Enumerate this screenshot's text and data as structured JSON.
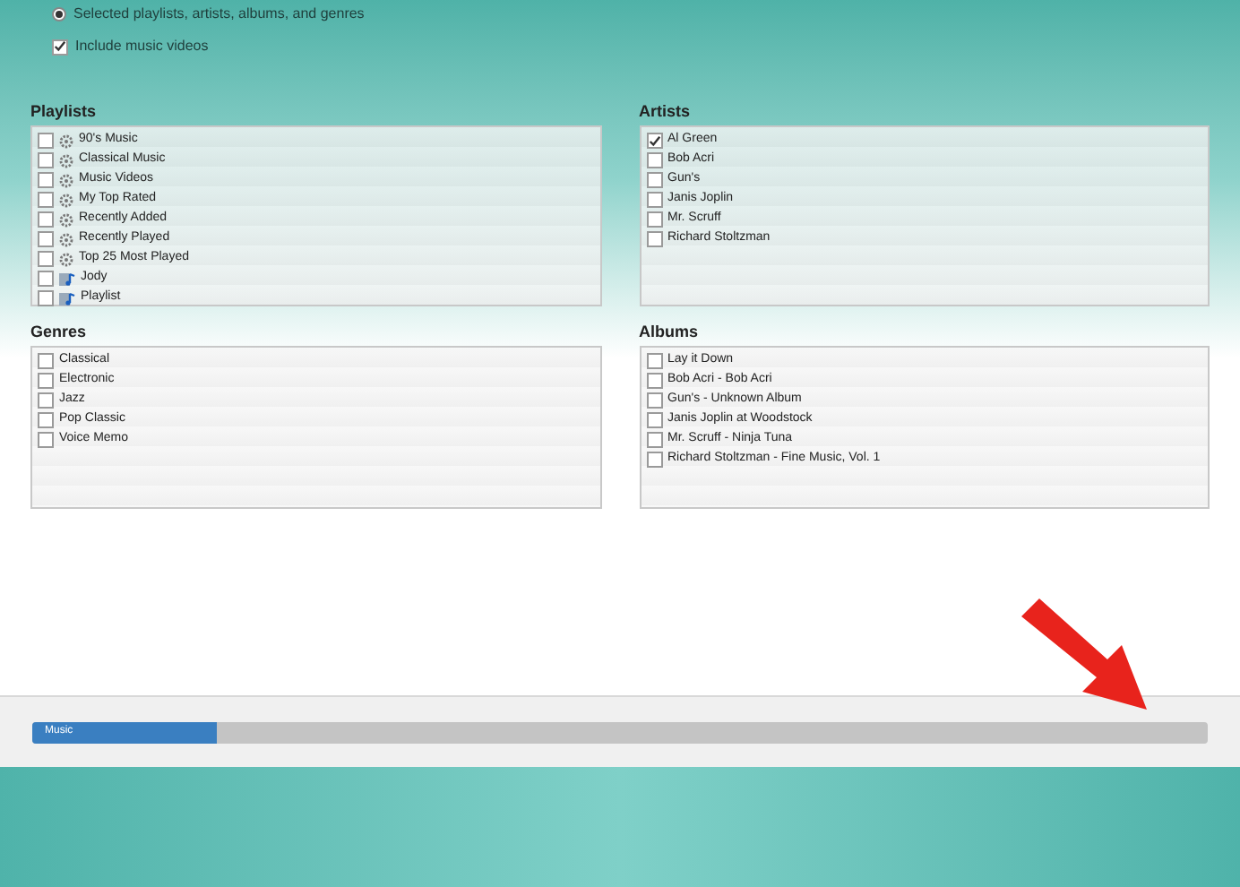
{
  "sync_options": [
    {
      "kind": "radio",
      "label": "Selected playlists, artists, albums, and genres",
      "selected": true
    },
    {
      "kind": "checkbox",
      "label": "Include music videos",
      "checked": true
    }
  ],
  "playlists": {
    "title": "Playlists",
    "items": [
      {
        "label": "90's Music",
        "kind": "smart",
        "checked": false
      },
      {
        "label": "Classical Music",
        "kind": "smart",
        "checked": false
      },
      {
        "label": "Music Videos",
        "kind": "smart",
        "checked": false
      },
      {
        "label": "My Top Rated",
        "kind": "smart",
        "checked": false
      },
      {
        "label": "Recently Added",
        "kind": "smart",
        "checked": false
      },
      {
        "label": "Recently Played",
        "kind": "smart",
        "checked": false
      },
      {
        "label": "Top 25 Most Played",
        "kind": "smart",
        "checked": false
      },
      {
        "label": "Jody",
        "kind": "regular",
        "checked": false
      },
      {
        "label": "Playlist",
        "kind": "regular",
        "checked": false
      }
    ]
  },
  "artists": {
    "title": "Artists",
    "items": [
      {
        "label": "Al Green",
        "checked": true
      },
      {
        "label": "Bob Acri",
        "checked": false
      },
      {
        "label": "Gun's",
        "checked": false
      },
      {
        "label": "Janis Joplin",
        "checked": false
      },
      {
        "label": "Mr. Scruff",
        "checked": false
      },
      {
        "label": "Richard Stoltzman",
        "checked": false
      }
    ]
  },
  "genres": {
    "title": "Genres",
    "items": [
      {
        "label": "Classical",
        "checked": false
      },
      {
        "label": "Electronic",
        "checked": false
      },
      {
        "label": "Jazz",
        "checked": false
      },
      {
        "label": "Pop Classic",
        "checked": false
      },
      {
        "label": "Voice Memo",
        "checked": false
      }
    ]
  },
  "albums": {
    "title": "Albums",
    "items": [
      {
        "label": "Lay it Down",
        "checked": false
      },
      {
        "label": "Bob Acri - Bob Acri",
        "checked": false
      },
      {
        "label": "Gun's - Unknown Album",
        "checked": false
      },
      {
        "label": "Janis Joplin at Woodstock",
        "checked": false
      },
      {
        "label": "Mr. Scruff - Ninja Tuna",
        "checked": false
      },
      {
        "label": "Richard Stoltzman - Fine Music, Vol. 1",
        "checked": false
      }
    ]
  },
  "capacity_bar": {
    "segments": [
      {
        "label": "Music",
        "level": 0.157
      }
    ]
  }
}
